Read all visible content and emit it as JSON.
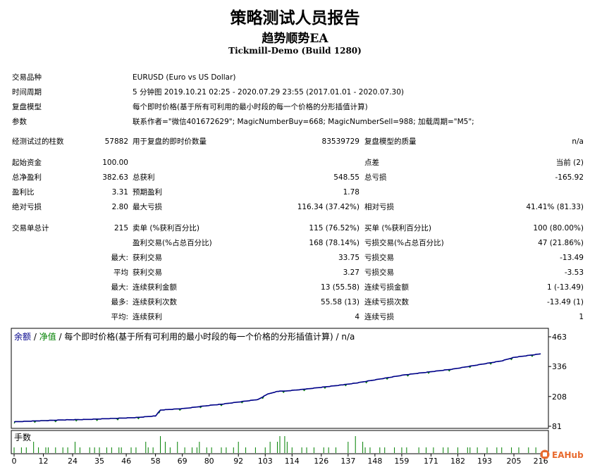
{
  "header": {
    "title": "策略测试人员报告",
    "subtitle": "趋势顺势EA",
    "server": "Tickmill-Demo (Build 1280)"
  },
  "rows": [
    {
      "y": 111,
      "cells": [
        {
          "x": 17,
          "text": "交易品种"
        },
        {
          "x": 188,
          "text": "EURUSD (Euro vs US Dollar)"
        }
      ]
    },
    {
      "y": 132,
      "cells": [
        {
          "x": 17,
          "text": "时间周期"
        },
        {
          "x": 188,
          "text": "5 分钟图 2019.10.21 02:25 - 2020.07.29 23:55 (2017.01.01 - 2020.07.30)"
        }
      ]
    },
    {
      "y": 153,
      "cells": [
        {
          "x": 17,
          "text": "复盘模型"
        },
        {
          "x": 188,
          "text": "每个即时价格(基于所有可利用的最小时段的每一个价格的分形插值计算)"
        }
      ]
    },
    {
      "y": 174,
      "cells": [
        {
          "x": 17,
          "text": "参数"
        },
        {
          "x": 188,
          "text": "联系作者=\"微信401672629\"; MagicNumberBuy=668; MagicNumberSell=988; 加载周期=\"M5\";"
        }
      ]
    },
    {
      "y": 202,
      "cells": [
        {
          "x": 17,
          "text": "经测试过的柱数"
        },
        {
          "r": 182,
          "text": "57882"
        },
        {
          "x": 188,
          "text": "用于复盘的即时价数量"
        },
        {
          "r": 510,
          "text": "83539729"
        },
        {
          "x": 517,
          "text": "复盘模型的质量"
        },
        {
          "r": 828,
          "text": "n/a"
        }
      ]
    },
    {
      "y": 232,
      "cells": [
        {
          "x": 17,
          "text": "起始资金"
        },
        {
          "r": 182,
          "text": "100.00"
        },
        {
          "x": 517,
          "text": "点差"
        },
        {
          "r": 828,
          "text": "当前 (2)"
        }
      ]
    },
    {
      "y": 253,
      "cells": [
        {
          "x": 17,
          "text": "总净盈利"
        },
        {
          "r": 182,
          "text": "382.63"
        },
        {
          "x": 188,
          "text": "总获利"
        },
        {
          "r": 510,
          "text": "548.55"
        },
        {
          "x": 517,
          "text": "总亏损"
        },
        {
          "r": 828,
          "text": "-165.92"
        }
      ]
    },
    {
      "y": 274,
      "cells": [
        {
          "x": 17,
          "text": "盈利比"
        },
        {
          "r": 182,
          "text": "3.31"
        },
        {
          "x": 188,
          "text": "预期盈利"
        },
        {
          "r": 510,
          "text": "1.78"
        }
      ]
    },
    {
      "y": 295,
      "cells": [
        {
          "x": 17,
          "text": "绝对亏损"
        },
        {
          "r": 182,
          "text": "2.80"
        },
        {
          "x": 188,
          "text": "最大亏损"
        },
        {
          "r": 510,
          "text": "116.34 (37.42%)"
        },
        {
          "x": 517,
          "text": "相对亏损"
        },
        {
          "r": 828,
          "text": "41.41% (81.33)"
        }
      ]
    },
    {
      "y": 325,
      "cells": [
        {
          "x": 17,
          "text": "交易单总计"
        },
        {
          "r": 182,
          "text": "215"
        },
        {
          "x": 188,
          "text": "卖单 (%获利百分比)"
        },
        {
          "r": 510,
          "text": "115 (76.52%)"
        },
        {
          "x": 517,
          "text": "买单 (%获利百分比)"
        },
        {
          "r": 828,
          "text": "100 (80.00%)"
        }
      ]
    },
    {
      "y": 346,
      "cells": [
        {
          "x": 188,
          "text": "盈利交易(%占总百分比)"
        },
        {
          "r": 510,
          "text": "168 (78.14%)"
        },
        {
          "x": 517,
          "text": "亏损交易(%占总百分比)"
        },
        {
          "r": 828,
          "text": "47 (21.86%)"
        }
      ]
    },
    {
      "y": 367,
      "cells": [
        {
          "r": 182,
          "text": "最大:"
        },
        {
          "x": 188,
          "text": "获利交易"
        },
        {
          "r": 510,
          "text": "33.75"
        },
        {
          "x": 517,
          "text": "亏损交易"
        },
        {
          "r": 828,
          "text": "-13.49"
        }
      ]
    },
    {
      "y": 388,
      "cells": [
        {
          "r": 182,
          "text": "平均"
        },
        {
          "x": 188,
          "text": "获利交易"
        },
        {
          "r": 510,
          "text": "3.27"
        },
        {
          "x": 517,
          "text": "亏损交易"
        },
        {
          "r": 828,
          "text": "-3.53"
        }
      ]
    },
    {
      "y": 409,
      "cells": [
        {
          "r": 182,
          "text": "最大:"
        },
        {
          "x": 188,
          "text": "连续获利金额"
        },
        {
          "r": 510,
          "text": "13 (55.58)"
        },
        {
          "x": 517,
          "text": "连续亏损金额"
        },
        {
          "r": 828,
          "text": "1 (-13.49)"
        }
      ]
    },
    {
      "y": 430,
      "cells": [
        {
          "r": 182,
          "text": "最多:"
        },
        {
          "x": 188,
          "text": "连续获利次数"
        },
        {
          "r": 510,
          "text": "55.58 (13)"
        },
        {
          "x": 517,
          "text": "连续亏损次数"
        },
        {
          "r": 828,
          "text": "-13.49 (1)"
        }
      ]
    },
    {
      "y": 451,
      "cells": [
        {
          "r": 182,
          "text": "平均:"
        },
        {
          "x": 188,
          "text": "连续获利"
        },
        {
          "r": 510,
          "text": "4"
        },
        {
          "x": 517,
          "text": "连续亏损"
        },
        {
          "r": 828,
          "text": "1"
        }
      ]
    }
  ],
  "chart": {
    "legend": {
      "balance": "余额",
      "sep1": " / ",
      "equity": "净值",
      "rest": " / 每个即时价格(基于所有可利用的最小时段的每一个价格的分形插值计算) / n/a"
    },
    "colors": {
      "balance": "#00008b",
      "equity": "#008000",
      "volume": "#008000",
      "grid": "#c8c8c8"
    },
    "y_ticks": [
      "463",
      "336",
      "208",
      "81"
    ],
    "volume_label": "手数",
    "x_ticks": [
      "0",
      "12",
      "24",
      "35",
      "46",
      "58",
      "69",
      "80",
      "92",
      "103",
      "114",
      "126",
      "137",
      "148",
      "159",
      "171",
      "182",
      "193",
      "205",
      "216"
    ],
    "volume_bars": [
      1,
      0,
      0,
      1,
      0,
      1,
      0,
      0,
      2,
      0,
      1,
      0,
      0,
      1,
      1,
      0,
      0,
      1,
      0,
      0,
      1,
      0,
      1,
      0,
      0,
      2,
      0,
      1,
      0,
      0,
      0,
      1,
      0,
      1,
      0,
      1,
      0,
      0,
      1,
      0,
      1,
      0,
      0,
      1,
      1,
      0,
      0,
      0,
      1,
      0,
      1,
      0,
      0,
      0,
      2,
      1,
      0,
      1,
      0,
      0,
      3,
      0,
      2,
      0,
      1,
      0,
      0,
      2,
      0,
      0,
      1,
      0,
      0,
      1,
      0,
      1,
      2,
      0,
      0,
      1,
      0,
      1,
      0,
      0,
      0,
      1,
      0,
      1,
      0,
      0,
      1,
      0,
      2,
      0,
      0,
      1,
      0,
      0,
      0,
      1,
      0,
      0,
      0,
      1,
      0,
      2,
      0,
      0,
      2,
      3,
      0,
      3,
      2,
      0,
      1,
      0,
      0,
      0,
      1,
      0,
      1,
      0,
      0,
      1,
      0,
      0,
      0,
      1,
      0,
      1,
      0,
      0,
      1,
      0,
      0,
      0,
      0,
      2,
      0,
      0,
      3,
      0,
      0,
      2,
      1,
      0,
      1,
      0,
      0,
      0,
      1,
      0,
      1,
      0,
      0,
      0,
      1,
      0,
      0,
      1,
      0,
      1,
      0,
      0,
      0,
      0,
      1,
      0,
      0,
      1,
      0,
      0,
      1,
      0,
      0,
      0,
      1,
      0,
      1,
      0,
      0,
      0,
      1,
      0,
      0,
      0,
      1,
      1,
      0,
      0,
      1,
      0,
      0,
      0,
      1,
      0,
      0,
      0,
      1,
      0,
      1,
      0,
      0,
      0,
      1,
      0,
      0,
      1,
      0,
      0,
      0,
      1,
      0,
      0,
      1,
      0,
      0
    ],
    "balance_path": [
      [
        0,
        100
      ],
      [
        20,
        108
      ],
      [
        30,
        110
      ],
      [
        50,
        118
      ],
      [
        58,
        125
      ],
      [
        60,
        150
      ],
      [
        70,
        157
      ],
      [
        80,
        170
      ],
      [
        85,
        175
      ],
      [
        100,
        195
      ],
      [
        104,
        218
      ],
      [
        108,
        230
      ],
      [
        112,
        232
      ],
      [
        120,
        240
      ],
      [
        135,
        258
      ],
      [
        140,
        265
      ],
      [
        160,
        300
      ],
      [
        180,
        325
      ],
      [
        200,
        360
      ],
      [
        205,
        375
      ],
      [
        216,
        390
      ]
    ]
  },
  "watermark": "EAHub"
}
